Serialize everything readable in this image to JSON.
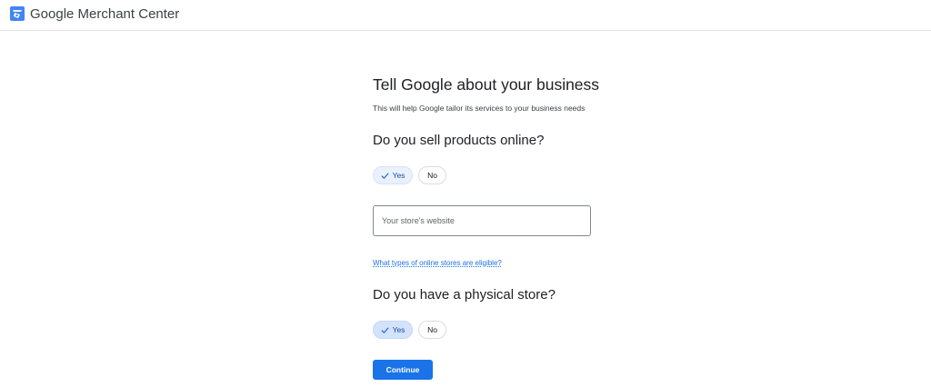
{
  "header": {
    "brand": "Google Merchant Center",
    "logo_icon": "merchant-center-logo-icon",
    "brand_color": "#4285f4"
  },
  "form": {
    "title": "Tell Google about your business",
    "subtitle": "This will help Google tailor its services to your business needs",
    "online_question": {
      "heading": "Do you sell products online?",
      "yes_label": "Yes",
      "no_label": "No",
      "selected": "Yes"
    },
    "website_input": {
      "placeholder": "Your store's website",
      "value": ""
    },
    "eligible_link": "What types of online stores are eligible?",
    "physical_question": {
      "heading": "Do you have a physical store?",
      "yes_label": "Yes",
      "no_label": "No",
      "selected": "Yes"
    },
    "continue_label": "Continue"
  },
  "colors": {
    "accent": "#1a73e8",
    "chip_selected_bg": "#e8f0fe",
    "chip_selected_text": "#1967d2",
    "divider": "#e3e3e3"
  }
}
